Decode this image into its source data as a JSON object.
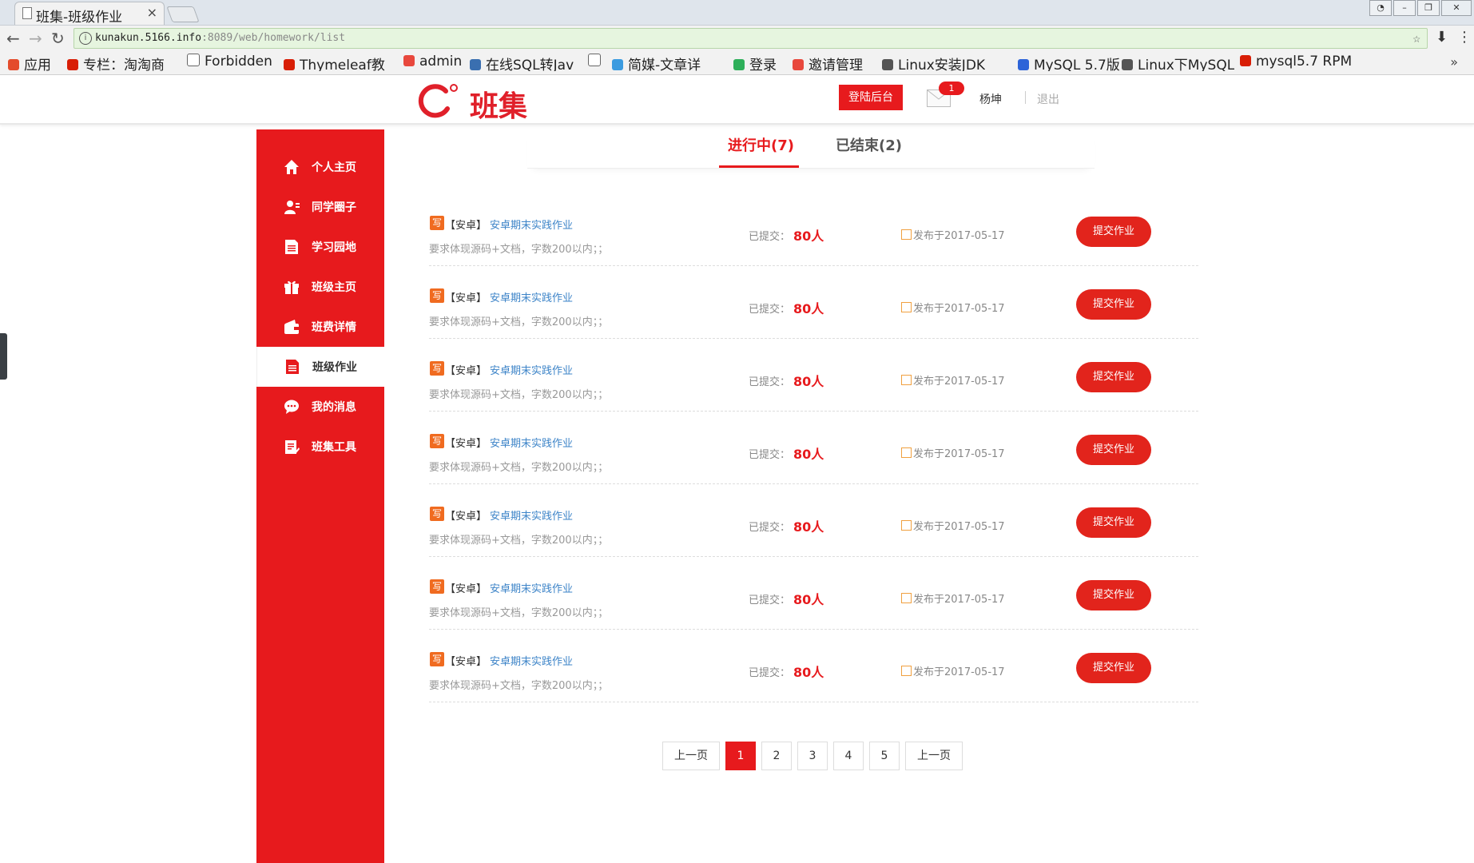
{
  "browser": {
    "tab_title": "班集-班级作业",
    "tab_close": "×",
    "url_host": "kunakun.5166.info",
    "url_path": ":8089/web/homework/list",
    "bookmarks": [
      {
        "label": "应用",
        "icon": "apps-grid-icon",
        "color": "#e44c2c"
      },
      {
        "label": "专栏：淘淘商",
        "icon": "csdn-icon",
        "color": "#d81e06"
      },
      {
        "label": "Forbidden",
        "icon": "page-icon",
        "color": "#ffffff"
      },
      {
        "label": "Thymeleaf教",
        "icon": "csdn-icon",
        "color": "#d81e06"
      },
      {
        "label": "admin",
        "icon": "admin-icon",
        "color": "#e8483d"
      },
      {
        "label": "在线SQL转Jav",
        "icon": "code-icon",
        "color": "#3a6fb0"
      },
      {
        "label": "",
        "icon": "page-icon",
        "color": "#ffffff"
      },
      {
        "label": "简媒-文章详",
        "icon": "jianmei-icon",
        "color": "#3b9be0"
      },
      {
        "label": "登录",
        "icon": "login-icon",
        "color": "#2eaf5a"
      },
      {
        "label": "邀请管理",
        "icon": "admin-icon",
        "color": "#e8483d"
      },
      {
        "label": "Linux安装JDK",
        "icon": "a-icon",
        "color": "#555555"
      },
      {
        "label": "MySQL 5.7版",
        "icon": "baidu-icon",
        "color": "#2d64d8"
      },
      {
        "label": "Linux下MySQL",
        "icon": "a-icon",
        "color": "#555555"
      },
      {
        "label": "mysql5.7 RPM",
        "icon": "csdn-icon",
        "color": "#d81e06"
      }
    ]
  },
  "header": {
    "logo_text": "班集",
    "admin_button": "登陆后台",
    "mail_badge": "1",
    "username": "杨坤",
    "logout": "退出"
  },
  "sidebar": {
    "items": [
      {
        "label": "个人主页",
        "icon": "home-icon",
        "active": false
      },
      {
        "label": "同学圈子",
        "icon": "user-group-icon",
        "active": false
      },
      {
        "label": "学习园地",
        "icon": "document-icon",
        "active": false
      },
      {
        "label": "班级主页",
        "icon": "gift-icon",
        "active": false
      },
      {
        "label": "班费详情",
        "icon": "wallet-icon",
        "active": false
      },
      {
        "label": "班级作业",
        "icon": "homework-icon",
        "active": true
      },
      {
        "label": "我的消息",
        "icon": "chat-icon",
        "active": false
      },
      {
        "label": "班集工具",
        "icon": "tools-icon",
        "active": false
      }
    ]
  },
  "tabs": {
    "in_progress": "进行中(7)",
    "ended": "已结束(2)"
  },
  "homework": {
    "badge": "写",
    "items": [
      {
        "tag": "【安卓】",
        "title": "安卓期末实践作业",
        "desc": "要求体现源码+文档，字数200以内；；",
        "submitted_label": "已提交：",
        "submitted_count": "80人",
        "date": "发布于2017-05-17",
        "action": "提交作业"
      },
      {
        "tag": "【安卓】",
        "title": "安卓期末实践作业",
        "desc": "要求体现源码+文档，字数200以内；；",
        "submitted_label": "已提交：",
        "submitted_count": "80人",
        "date": "发布于2017-05-17",
        "action": "提交作业"
      },
      {
        "tag": "【安卓】",
        "title": "安卓期末实践作业",
        "desc": "要求体现源码+文档，字数200以内；；",
        "submitted_label": "已提交：",
        "submitted_count": "80人",
        "date": "发布于2017-05-17",
        "action": "提交作业"
      },
      {
        "tag": "【安卓】",
        "title": "安卓期末实践作业",
        "desc": "要求体现源码+文档，字数200以内；；",
        "submitted_label": "已提交：",
        "submitted_count": "80人",
        "date": "发布于2017-05-17",
        "action": "提交作业"
      },
      {
        "tag": "【安卓】",
        "title": "安卓期末实践作业",
        "desc": "要求体现源码+文档，字数200以内；；",
        "submitted_label": "已提交：",
        "submitted_count": "80人",
        "date": "发布于2017-05-17",
        "action": "提交作业"
      },
      {
        "tag": "【安卓】",
        "title": "安卓期末实践作业",
        "desc": "要求体现源码+文档，字数200以内；；",
        "submitted_label": "已提交：",
        "submitted_count": "80人",
        "date": "发布于2017-05-17",
        "action": "提交作业"
      },
      {
        "tag": "【安卓】",
        "title": "安卓期末实践作业",
        "desc": "要求体现源码+文档，字数200以内；；",
        "submitted_label": "已提交：",
        "submitted_count": "80人",
        "date": "发布于2017-05-17",
        "action": "提交作业"
      }
    ]
  },
  "pagination": {
    "prev": "上一页",
    "pages": [
      "1",
      "2",
      "3",
      "4",
      "5"
    ],
    "current": "1",
    "next": "上一页"
  },
  "colors": {
    "brand_red": "#e71a1d",
    "link_blue": "#3d84c8",
    "badge_orange": "#f06b20"
  }
}
